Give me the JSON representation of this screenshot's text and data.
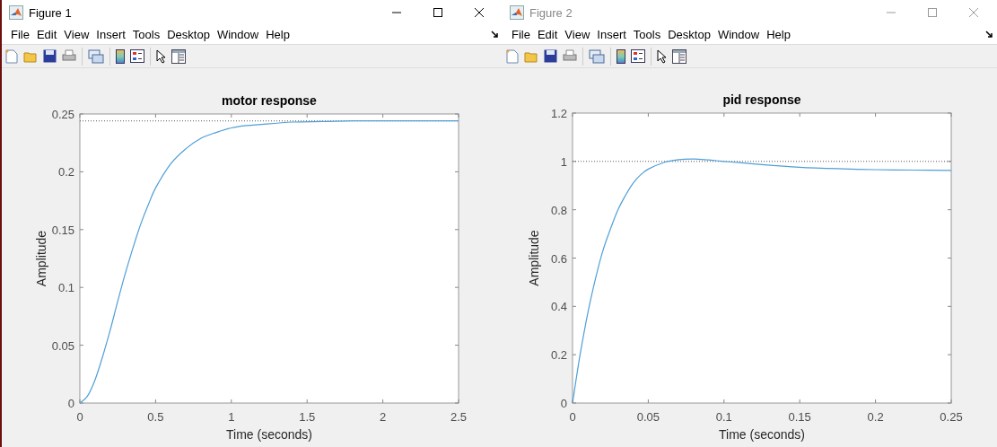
{
  "windows": [
    {
      "title": "Figure 1",
      "active": true,
      "menu": [
        "File",
        "Edit",
        "View",
        "Insert",
        "Tools",
        "Desktop",
        "Window",
        "Help"
      ],
      "chart_data": {
        "type": "line",
        "title": "motor response",
        "xlabel": "Time (seconds)",
        "ylabel": "Amplitude",
        "xlim": [
          0,
          2.5
        ],
        "ylim": [
          0,
          0.25
        ],
        "xticks": [
          0,
          0.5,
          1,
          1.5,
          2,
          2.5
        ],
        "yticks": [
          0,
          0.05,
          0.1,
          0.15,
          0.2,
          0.25
        ],
        "x": [
          0,
          0.05,
          0.1,
          0.15,
          0.2,
          0.25,
          0.3,
          0.35,
          0.4,
          0.45,
          0.5,
          0.6,
          0.7,
          0.8,
          0.9,
          1.0,
          1.1,
          1.2,
          1.4,
          1.6,
          1.8,
          2.0,
          2.5
        ],
        "series": [
          {
            "color": "#4f9fd6",
            "values": [
              0,
              0.006,
              0.02,
              0.04,
              0.063,
              0.088,
              0.112,
              0.134,
              0.154,
              0.171,
              0.186,
              0.207,
              0.22,
              0.229,
              0.234,
              0.238,
              0.24,
              0.241,
              0.243,
              0.2435,
              0.244,
              0.244,
              0.244
            ]
          }
        ],
        "ref_lines": [
          {
            "axis": "y",
            "value": 0.244
          }
        ]
      }
    },
    {
      "title": "Figure 2",
      "active": false,
      "menu": [
        "File",
        "Edit",
        "View",
        "Insert",
        "Tools",
        "Desktop",
        "Window",
        "Help"
      ],
      "chart_data": {
        "type": "line",
        "title": "pid response",
        "xlabel": "Time (seconds)",
        "ylabel": "Amplitude",
        "xlim": [
          0,
          0.25
        ],
        "ylim": [
          0,
          1.2
        ],
        "xticks": [
          0,
          0.05,
          0.1,
          0.15,
          0.2,
          0.25
        ],
        "yticks": [
          0,
          0.2,
          0.4,
          0.6,
          0.8,
          1,
          1.2
        ],
        "x": [
          0,
          0.005,
          0.01,
          0.015,
          0.02,
          0.025,
          0.03,
          0.035,
          0.04,
          0.045,
          0.05,
          0.06,
          0.07,
          0.08,
          0.09,
          0.1,
          0.11,
          0.125,
          0.15,
          0.175,
          0.2,
          0.225,
          0.25
        ],
        "series": [
          {
            "color": "#4f9fd6",
            "values": [
              0,
              0.2,
              0.37,
              0.51,
              0.63,
              0.72,
              0.8,
              0.86,
              0.91,
              0.945,
              0.968,
              0.995,
              1.007,
              1.01,
              1.006,
              1.0,
              0.995,
              0.987,
              0.976,
              0.97,
              0.966,
              0.964,
              0.963
            ]
          }
        ],
        "ref_lines": [
          {
            "axis": "y",
            "value": 1
          }
        ]
      }
    }
  ]
}
